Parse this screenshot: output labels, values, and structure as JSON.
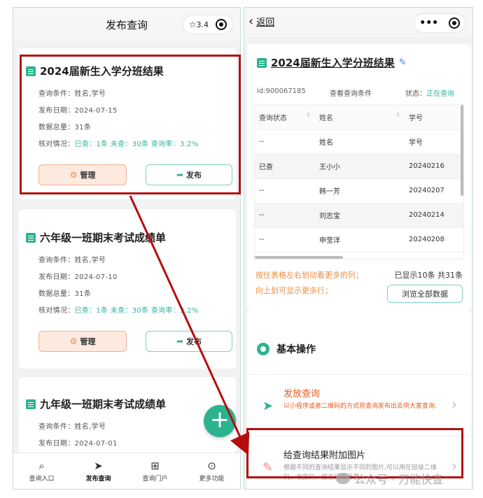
{
  "left": {
    "header": {
      "title": "发布查询",
      "rating": "3.4"
    },
    "cards": [
      {
        "title": "2024届新生入学分班结果",
        "conditions": "查询条件：姓名,学号",
        "date": "发布日期：2024-07-15",
        "total": "数据总量：31条",
        "check_label": "核对情况：",
        "check_value": "已查：1条 未查：30条 查询率：3.2%",
        "manage": "管理",
        "publish": "发布"
      },
      {
        "title": "六年级一班期末考试成绩单",
        "conditions": "查询条件：姓名,学号",
        "date": "发布日期：2024-07-10",
        "total": "数据总量：31条",
        "check_label": "核对情况：",
        "check_value": "已查：1条 未查：30条 查询率：3.2%",
        "manage": "管理",
        "publish": "发布"
      },
      {
        "title": "九年级一班期末考试成绩单",
        "conditions": "查询条件：姓名,学号",
        "date": "发布日期：2024-07-01"
      }
    ],
    "tabs": [
      {
        "label": "查询入口",
        "icon": "search-icon"
      },
      {
        "label": "发布查询",
        "icon": "send-icon"
      },
      {
        "label": "查询门户",
        "icon": "sitemap-icon"
      },
      {
        "label": "更多功能",
        "icon": "more-icon"
      }
    ],
    "fab": "+"
  },
  "right": {
    "back": "返回",
    "title": "2024届新生入学分班结果",
    "id": "id:900067185",
    "view_conditions": "查看查询条件",
    "status_label": "状态：",
    "status_value": "正在查询",
    "table": {
      "headers": [
        "查询状态",
        "姓名",
        "学号"
      ],
      "rows": [
        [
          "--",
          "姓名",
          "学号"
        ],
        [
          "已查",
          "王小小",
          "20240216"
        ],
        [
          "--",
          "韩一芳",
          "20240207"
        ],
        [
          "--",
          "刘志宝",
          "20240214"
        ],
        [
          "--",
          "申莹洋",
          "20240208"
        ]
      ]
    },
    "hint1": "按住表格左右划动看更多的列；",
    "hint2": "向上划可显示更多行；",
    "count": "已显示10条 共31条",
    "view_all": "浏览全部数据",
    "section_title": "基本操作",
    "ops": [
      {
        "name": "发放查询",
        "desc": "以小程序或者二维码的方式将查询发布出去供大家查询."
      },
      {
        "name": "给查询结果附加图片",
        "desc": "根据不同的查询结果显示不同的图片,可以用在班级二维码、收款码、报名码等场景."
      }
    ]
  },
  "watermark": "公众号 · 万能快查",
  "colors": {
    "accent": "#2bb38f",
    "highlight": "#b50d0d",
    "orange": "#f08c3c"
  }
}
